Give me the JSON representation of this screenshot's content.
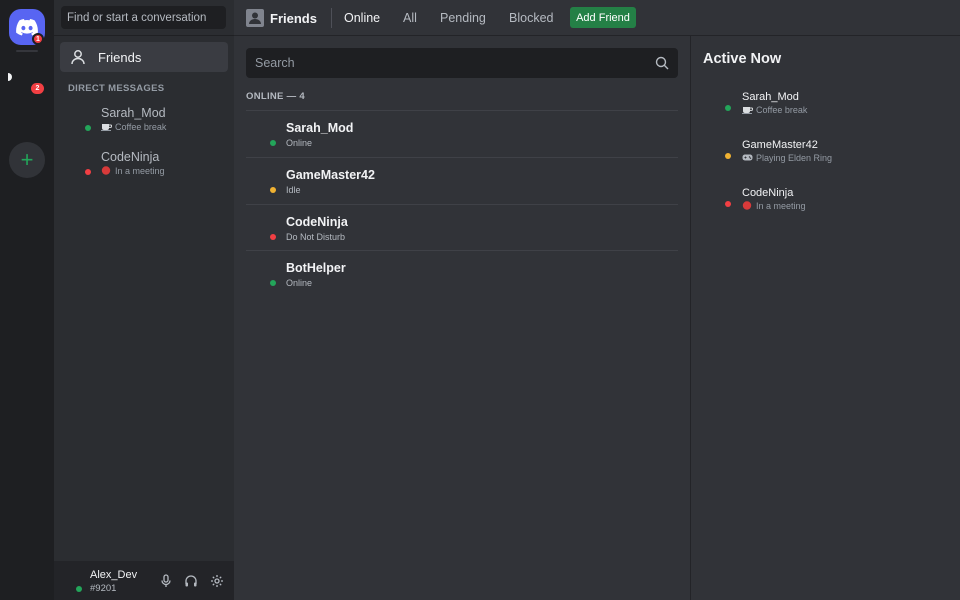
{
  "rail": {
    "home_badge": "1",
    "server_badge": "2",
    "add_server_glyph": "+"
  },
  "dm": {
    "search_placeholder": "Find or start a conversation",
    "friends_label": "Friends",
    "section_title": "DIRECT MESSAGES",
    "items": [
      {
        "name": "Sarah_Mod",
        "status": "online",
        "activity": "Coffee break",
        "emoji": "coffee-icon"
      },
      {
        "name": "CodeNinja",
        "status": "dnd",
        "activity": "In a meeting",
        "emoji": "red-circle-icon"
      }
    ]
  },
  "user": {
    "name": "Alex_Dev",
    "tag": "#9201",
    "status": "online"
  },
  "header": {
    "title": "Friends",
    "tabs": [
      "Online",
      "All",
      "Pending",
      "Blocked"
    ],
    "active_tab": "Online",
    "add_friend_label": "Add Friend"
  },
  "friends": {
    "search_placeholder": "Search",
    "online_heading": "ONLINE — 4",
    "rows": [
      {
        "name": "Sarah_Mod",
        "status": "online",
        "status_text": "Online"
      },
      {
        "name": "GameMaster42",
        "status": "idle",
        "status_text": "Idle"
      },
      {
        "name": "CodeNinja",
        "status": "dnd",
        "status_text": "Do Not Disturb"
      },
      {
        "name": "BotHelper",
        "status": "online",
        "status_text": "Online"
      }
    ]
  },
  "active_now": {
    "title": "Active Now",
    "items": [
      {
        "name": "Sarah_Mod",
        "status": "online",
        "activity": "Coffee break",
        "emoji": "coffee-icon"
      },
      {
        "name": "GameMaster42",
        "status": "idle",
        "activity": "Playing Elden Ring",
        "emoji": "gamepad-icon"
      },
      {
        "name": "CodeNinja",
        "status": "dnd",
        "activity": "In a meeting",
        "emoji": "red-circle-icon"
      }
    ]
  },
  "colors": {
    "online": "#23a55a",
    "idle": "#f0b232",
    "dnd": "#f23f43",
    "brand": "#5865f2",
    "add_friend": "#248046"
  }
}
